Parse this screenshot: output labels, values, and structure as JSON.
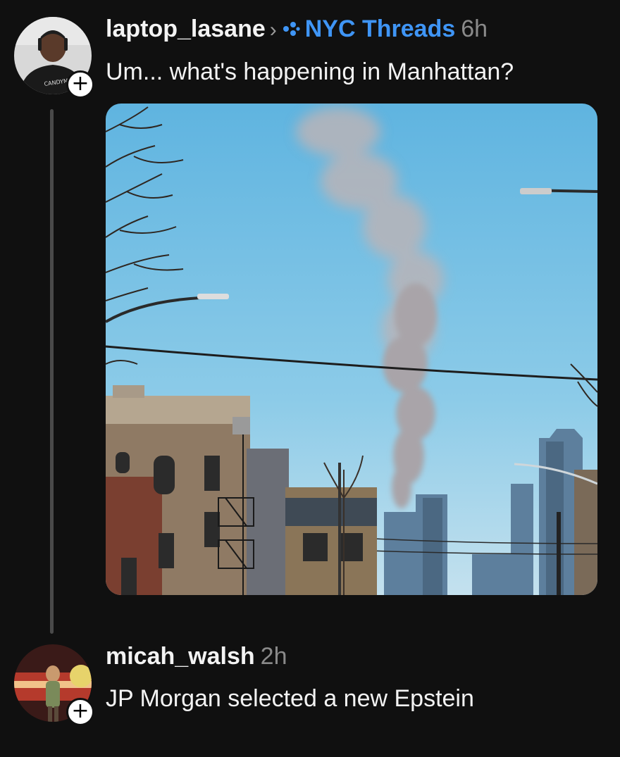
{
  "post": {
    "username": "laptop_lasane",
    "separator": "›",
    "community": "NYC Threads",
    "time": "6h",
    "text": "Um... what's happening in Manhattan?",
    "avatar_shirt_text": "CANDYM",
    "follow_icon": "plus-icon",
    "community_icon": "dots-cluster-icon"
  },
  "reply": {
    "username": "micah_walsh",
    "time": "2h",
    "text": "JP Morgan selected a new Epstein",
    "follow_icon": "plus-icon"
  },
  "colors": {
    "background": "#101010",
    "community_accent": "#3f95f5",
    "muted": "#8a8a8a"
  }
}
